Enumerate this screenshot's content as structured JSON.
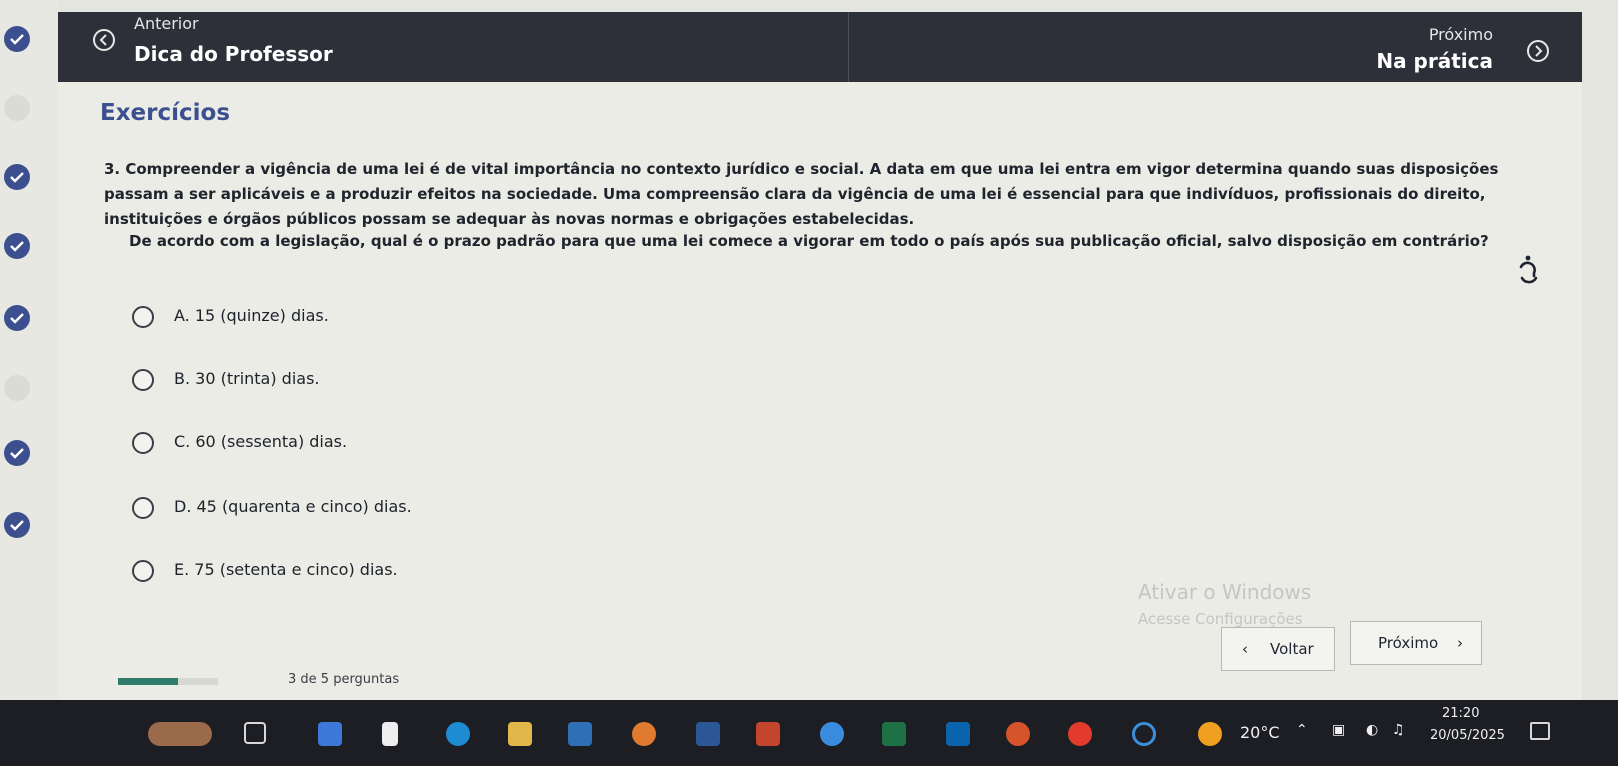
{
  "nav": {
    "prev_label": "Anterior",
    "prev_title": "Dica do Professor",
    "next_label": "Próximo",
    "next_title": "Na prática"
  },
  "section_title": "Exercícios",
  "question": {
    "statement": "3. Compreender a vigência de uma lei é de vital importância no contexto jurídico e social. A data em que uma lei entra em vigor determina quando suas disposições passam a ser aplicáveis e a produzir efeitos na sociedade. Uma compreensão clara da vigência de uma lei é essencial para que indivíduos, profissionais do direito, instituições e órgãos públicos possam se adequar às novas normas e obrigações estabelecidas.",
    "prompt": "De acordo com a legislação, qual é o prazo padrão para que uma lei comece a vigorar em todo o país após sua publicação oficial, salvo disposição em contrário?"
  },
  "options": [
    {
      "label": "A. 15 (quinze) dias."
    },
    {
      "label": "B. 30 (trinta) dias."
    },
    {
      "label": "C. 60 (sessenta) dias."
    },
    {
      "label": "D. 45 (quarenta e cinco) dias."
    },
    {
      "label": "E. 75 (setenta e cinco) dias."
    }
  ],
  "buttons": {
    "back_label": "Voltar",
    "next_label": "Próximo"
  },
  "progress": {
    "text": "3 de 5 perguntas",
    "fraction": 0.6
  },
  "watermark": {
    "line1": "Ativar o Windows",
    "line2": "Acesse Configurações"
  },
  "taskbar": {
    "temperature": "20°C",
    "time": "21:20",
    "date": "20/05/2025"
  },
  "colors": {
    "accent": "#3c4f8f",
    "topbar": "#2d3038",
    "progress": "#2e7d6a"
  }
}
